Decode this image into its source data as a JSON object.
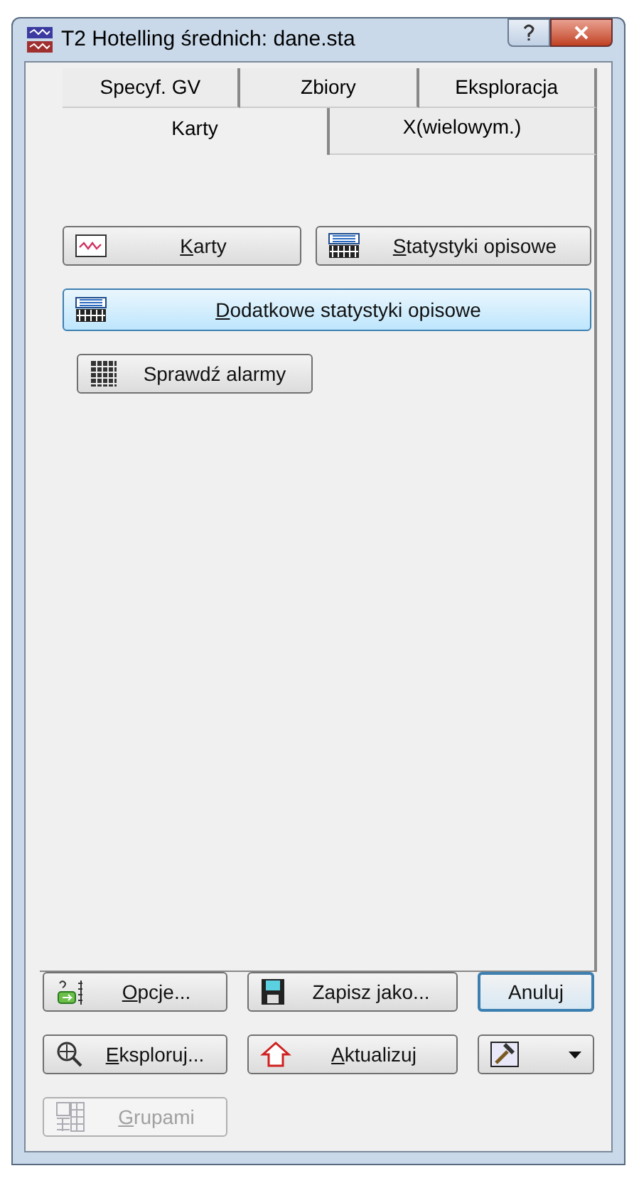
{
  "window": {
    "title": "T2 Hotelling średnich: dane.sta"
  },
  "tabs_back": [
    {
      "label": "Specyf. GV",
      "selected": false
    },
    {
      "label": "Zbiory",
      "selected": false
    },
    {
      "label": "Eksploracja",
      "selected": false
    }
  ],
  "tabs_front": [
    {
      "label": "Karty",
      "selected": true
    },
    {
      "label": "X(wielowym.)",
      "selected": false
    }
  ],
  "panel_buttons": [
    {
      "label": "Karty",
      "kind": "chart",
      "underline_first": true,
      "highlighted": false
    },
    {
      "label": "Statystyki opisowe",
      "kind": "sum",
      "underline_first": true,
      "highlighted": false
    },
    {
      "label": "Dodatkowe statystyki opisowe",
      "kind": "sum",
      "underline_first": true,
      "highlighted": true
    },
    {
      "label": "Sprawdź alarmy",
      "kind": "grid",
      "underline_first": false,
      "highlighted": false
    }
  ],
  "bottom_buttons": [
    {
      "label": "Opcje...",
      "kind": "options",
      "underline_first": true,
      "default": false,
      "disabled": false
    },
    {
      "label": "Zapisz jako...",
      "kind": "disk",
      "underline_first": false,
      "default": false,
      "disabled": false
    },
    {
      "label": "Anuluj",
      "kind": "plain",
      "underline_first": false,
      "default": true,
      "disabled": false
    },
    {
      "label": "Eksploruj...",
      "kind": "explore",
      "underline_first": true,
      "default": false,
      "disabled": false
    },
    {
      "label": "Aktualizuj",
      "kind": "house",
      "underline_first": true,
      "default": false,
      "disabled": false
    },
    {
      "label": "Grupami",
      "kind": "by",
      "underline_first": true,
      "default": false,
      "disabled": true
    }
  ]
}
